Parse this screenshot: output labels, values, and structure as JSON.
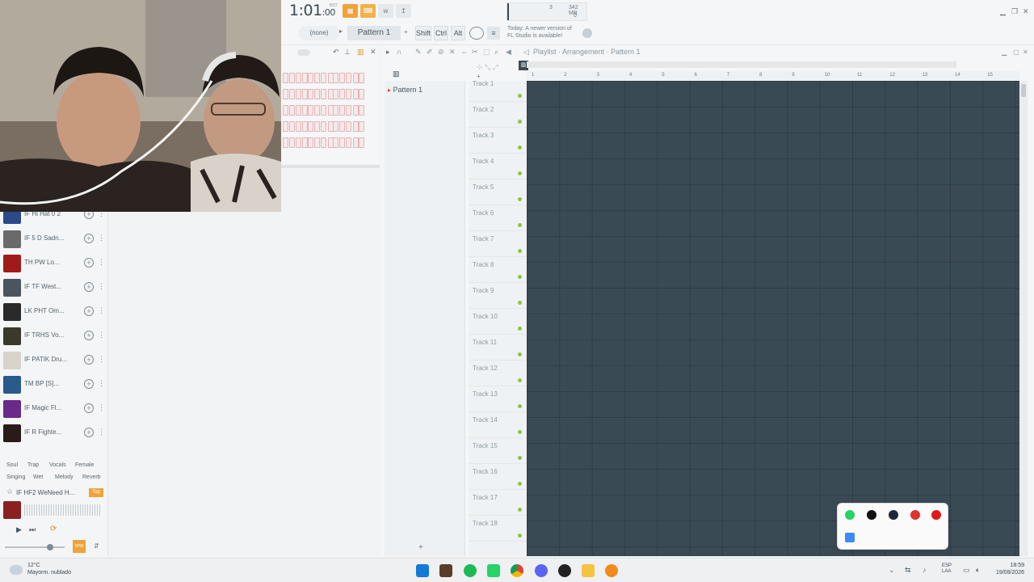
{
  "transport": {
    "time_main": "1:01",
    "time_sub": "00",
    "time_label": "BST"
  },
  "monitor": {
    "value_a": "3",
    "value_b": "342 MB",
    "value_c": "0"
  },
  "toolbar": {
    "none_label": "(none)",
    "pattern_label": "Pattern 1",
    "shift_key": "Shift",
    "ctrl_key": "Ctrl",
    "alt_key": "Alt"
  },
  "news": {
    "line1": "Today: A newer version of",
    "line2": "FL Studio is available!"
  },
  "playlist": {
    "breadcrumb": "Playlist · Arrangement · Pattern 1",
    "picker_items": [
      "Pattern 1"
    ],
    "tracks": [
      "Track 1",
      "Track 2",
      "Track 3",
      "Track 4",
      "Track 5",
      "Track 6",
      "Track 7",
      "Track 8",
      "Track 9",
      "Track 10",
      "Track 11",
      "Track 12",
      "Track 13",
      "Track 14",
      "Track 15",
      "Track 16",
      "Track 17",
      "Track 18"
    ],
    "ruler": [
      "1",
      "2",
      "3",
      "4",
      "5",
      "6",
      "7",
      "8",
      "9",
      "10",
      "11",
      "12",
      "13",
      "14",
      "15"
    ]
  },
  "browser": {
    "items": [
      {
        "label": "IF Hi Hat 0 2",
        "color": "#2c4a8a"
      },
      {
        "label": "IF 5 D Sadn...",
        "color": "#6a6a6a"
      },
      {
        "label": "TH PW Lo...",
        "color": "#a11a1a"
      },
      {
        "label": "IF TF West...",
        "color": "#4a5560"
      },
      {
        "label": "LK PHT Om...",
        "color": "#2a2a2a"
      },
      {
        "label": "IF TRHS Vo...",
        "color": "#3a3a2a"
      },
      {
        "label": "IF PATIK Dru...",
        "color": "#d8d4ca"
      },
      {
        "label": "TM BP [S]...",
        "color": "#2a5a8a"
      },
      {
        "label": "IF Magic Fl...",
        "color": "#6a2a8a"
      },
      {
        "label": "IF R Fighte...",
        "color": "#2a1a1a"
      }
    ],
    "tags_row1": [
      "Soul",
      "Trap",
      "Vocals",
      "Female"
    ],
    "tags_row2": [
      "Singing",
      "Wet",
      "Melody",
      "Reverb"
    ],
    "now_playing": "IF HF2 WeNeed H...",
    "now_playing_badge": "Top",
    "bpm_label": "BPM"
  },
  "taskbar": {
    "temperature": "12°C",
    "weather": "Mayorm. nublado",
    "language_line1": "ESP",
    "language_line2": "LAA",
    "time": "18:59",
    "date": "19/08/2026"
  }
}
